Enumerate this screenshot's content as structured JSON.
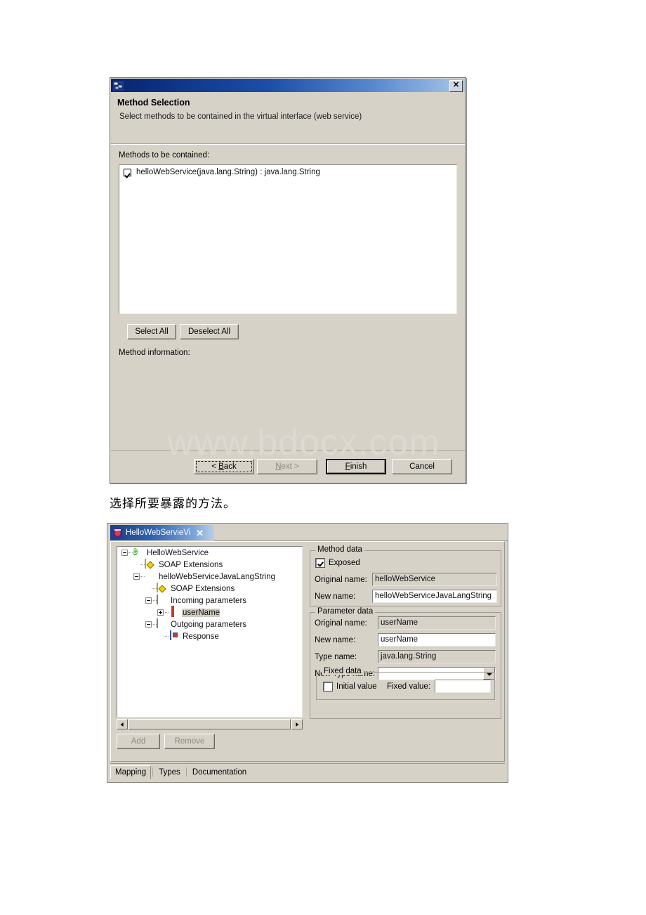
{
  "dialog": {
    "icon": "web-service-icon",
    "close_label": "✕",
    "header_title": "Method Selection",
    "header_subtitle": "Select methods to be contained in the virtual interface (web service)",
    "methods_label": "Methods to be contained:",
    "methods": [
      {
        "checked": true,
        "text": "helloWebService(java.lang.String) : java.lang.String"
      }
    ],
    "select_all_label": "Select All",
    "deselect_all_label": "Deselect All",
    "method_information_label": "Method information:",
    "buttons": {
      "back_pre": "< ",
      "back_accel": "B",
      "back_post": "ack",
      "next_pre": "",
      "next_accel": "N",
      "next_post": "ext >",
      "finish_pre": "",
      "finish_accel": "F",
      "finish_post": "inish",
      "cancel_label": "Cancel"
    }
  },
  "watermark": "www.bdocx.com",
  "caption_cn": "选择所要暴露的方法。",
  "editor": {
    "tab": {
      "icon": "virtual-interface-icon",
      "label": "HelloWebServieVi",
      "close": "✕"
    },
    "tree": [
      {
        "indent": 0,
        "toggle": "minus",
        "icon": "class-icon",
        "label": "HelloWebService",
        "selected": false
      },
      {
        "indent": 1,
        "toggle": "none",
        "icon": "soap-icon",
        "label": "SOAP Extensions",
        "selected": false
      },
      {
        "indent": 1,
        "toggle": "minus",
        "icon": "method-icon",
        "label": "helloWebServiceJavaLangString",
        "selected": false
      },
      {
        "indent": 2,
        "toggle": "none",
        "icon": "soap-icon",
        "label": "SOAP Extensions",
        "selected": false
      },
      {
        "indent": 2,
        "toggle": "minus",
        "icon": "doc-icon",
        "label": "Incoming parameters",
        "selected": false
      },
      {
        "indent": 3,
        "toggle": "plus",
        "icon": "param-icon",
        "label": "userName",
        "selected": true
      },
      {
        "indent": 2,
        "toggle": "minus",
        "icon": "doc-icon",
        "label": "Outgoing parameters",
        "selected": false
      },
      {
        "indent": 3,
        "toggle": "none",
        "icon": "response-icon",
        "label": "Response",
        "selected": false
      }
    ],
    "add_label": "Add",
    "remove_label": "Remove",
    "method_data": {
      "group_label": "Method data",
      "exposed_label": "Exposed",
      "exposed_checked": true,
      "original_name_label": "Original name:",
      "original_name_value": "helloWebService",
      "new_name_label": "New name:",
      "new_name_value": "helloWebServiceJavaLangString"
    },
    "parameter_data": {
      "group_label": "Parameter data",
      "original_name_label": "Original name:",
      "original_name_value": "userName",
      "new_name_label": "New name:",
      "new_name_value": "userName",
      "type_name_label": "Type name:",
      "type_name_value": "java.lang.String",
      "new_type_name_label": "New Type name:",
      "new_type_name_value": "",
      "fixed_data": {
        "group_label": "Fixed data",
        "initial_value_label": "Initial value",
        "initial_value_checked": false,
        "fixed_value_label": "Fixed value:",
        "fixed_value": ""
      }
    },
    "bottom_tabs": [
      {
        "label": "Mapping",
        "active": true
      },
      {
        "label": "Types",
        "active": false
      },
      {
        "label": "Documentation",
        "active": false
      }
    ]
  },
  "colors": {
    "window_face": "#d6d2c8",
    "title_blue": "#0a246a",
    "tab_blue": "#1d3f86",
    "watermark": "#ddd9d2",
    "selection": "#d0ccc0"
  }
}
